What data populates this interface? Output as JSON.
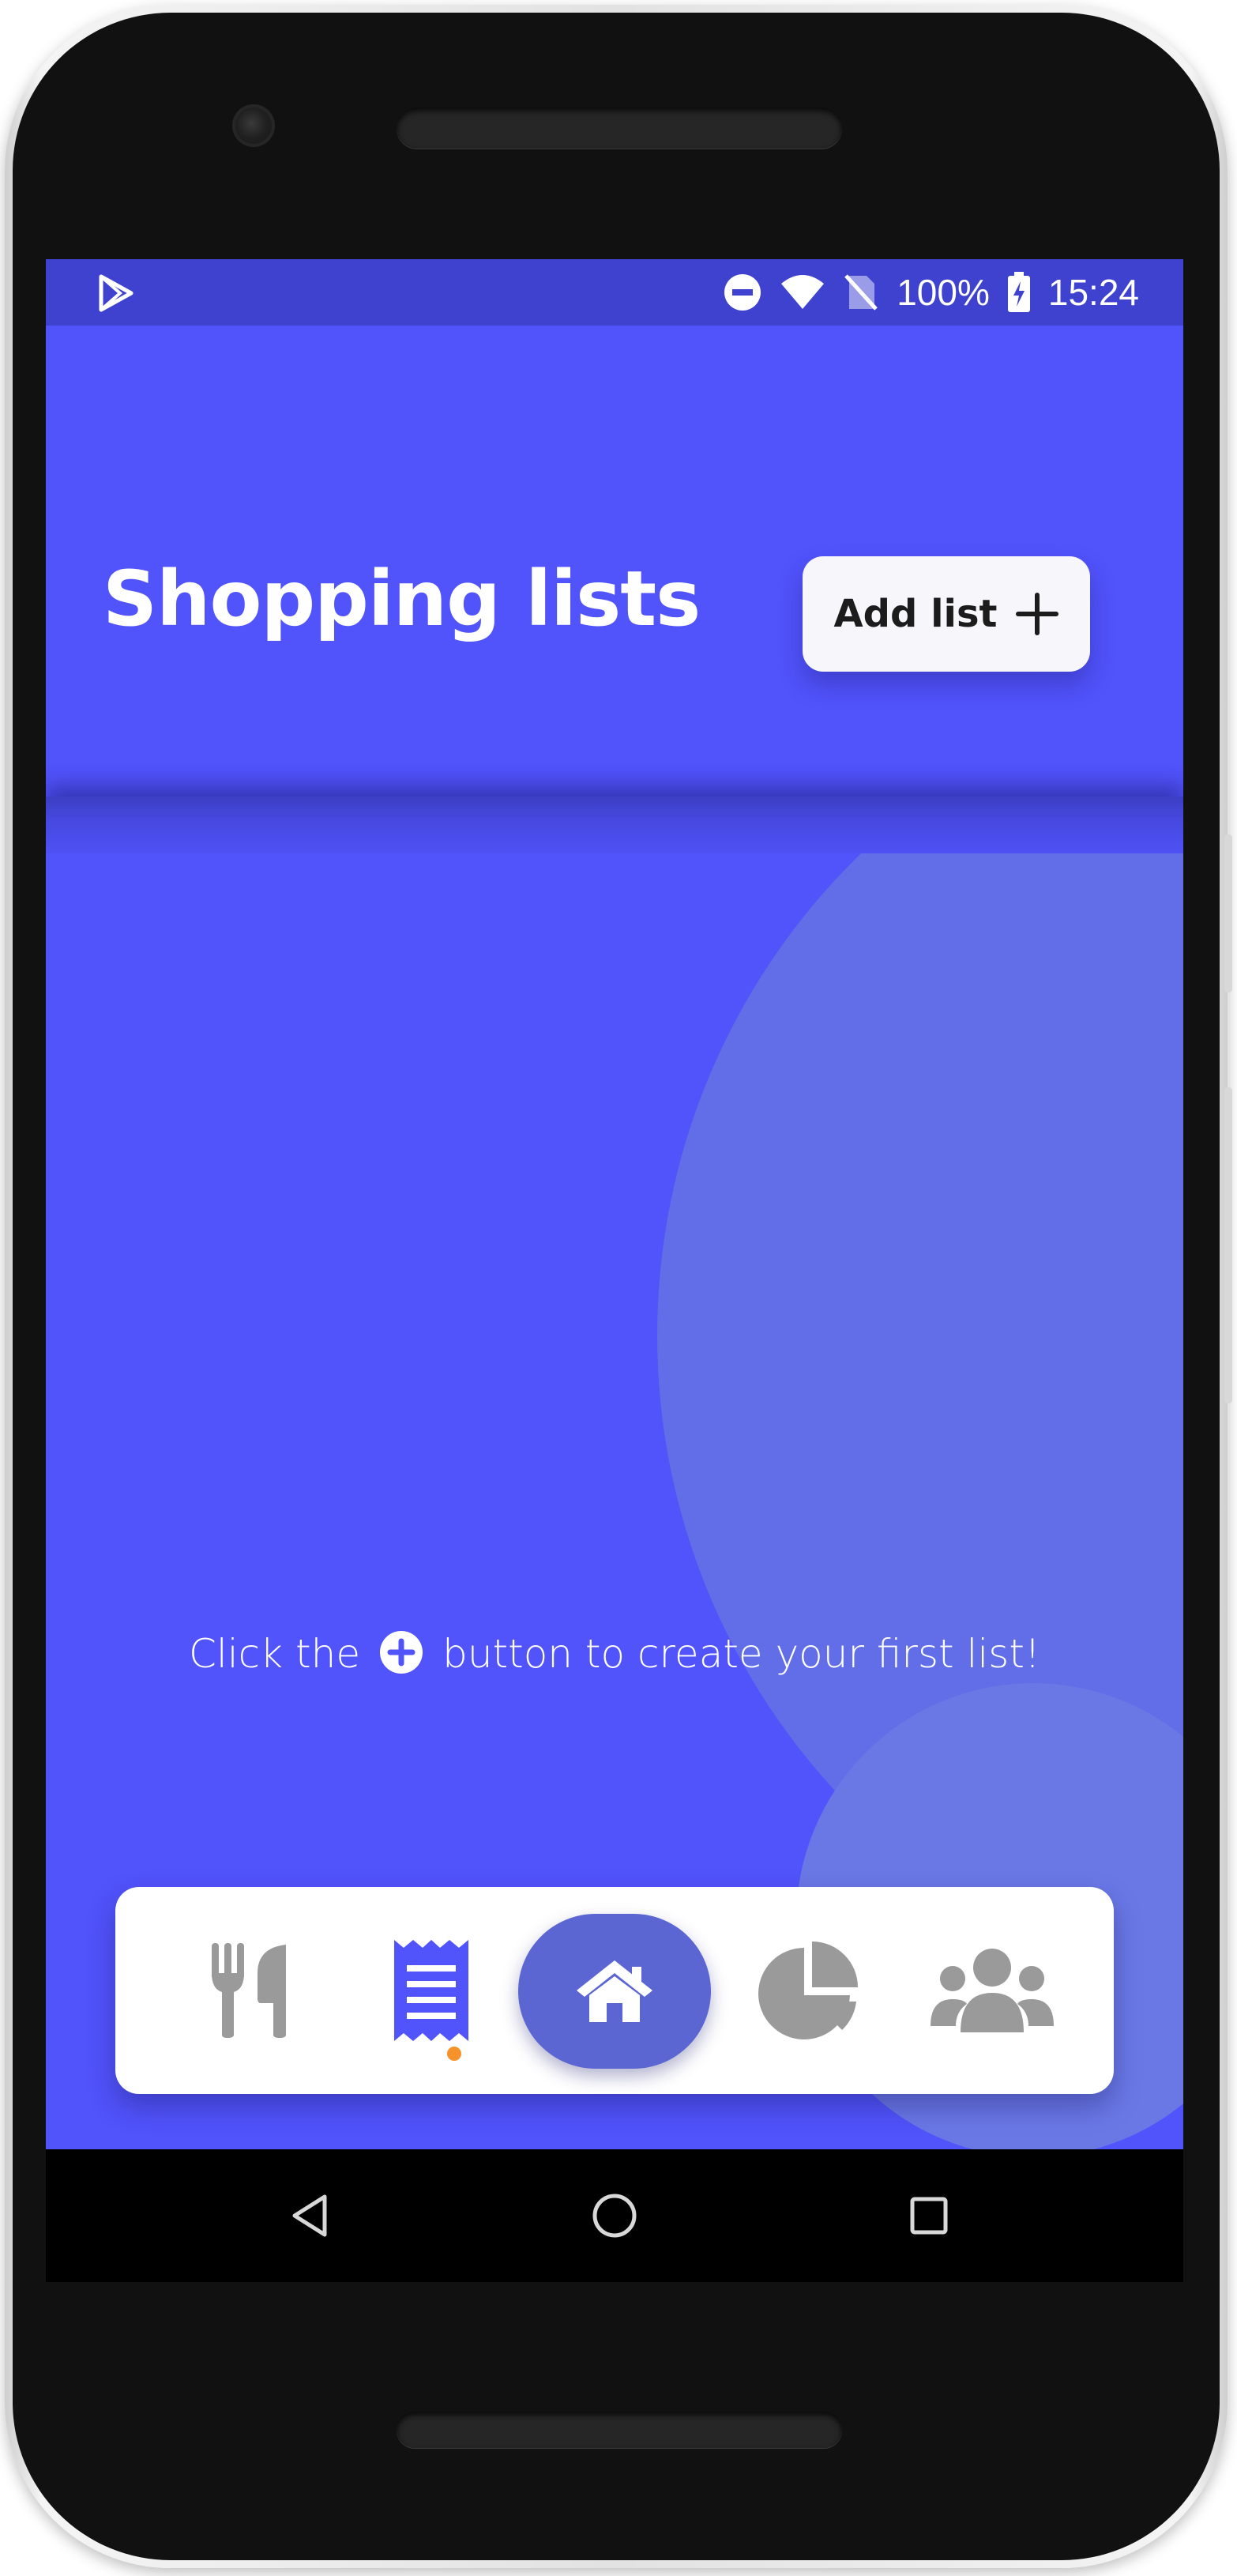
{
  "status_bar": {
    "battery": "100%",
    "time": "15:24",
    "icons": [
      "play-store-icon",
      "do-not-disturb-icon",
      "wifi-icon",
      "no-sim-icon",
      "battery-charging-icon"
    ]
  },
  "header": {
    "title": "Shopping lists",
    "add_button_label": "Add list",
    "add_button_icon": "plus-icon"
  },
  "empty_state": {
    "text_before": "Click the",
    "icon": "plus-circle-icon",
    "text_after": "button to create your first list!"
  },
  "bottom_nav": {
    "items": [
      {
        "icon": "fork-knife-icon",
        "active": false
      },
      {
        "icon": "receipt-list-icon",
        "active": true
      },
      {
        "icon": "home-icon",
        "active": false,
        "emphasized": true
      },
      {
        "icon": "pie-chart-icon",
        "active": false
      },
      {
        "icon": "users-group-icon",
        "active": false
      }
    ]
  },
  "system_nav": {
    "buttons": [
      "back-icon",
      "home-circle-icon",
      "recents-icon"
    ]
  },
  "colors": {
    "primary": "#5153fb",
    "status_bar": "#3f42cf",
    "active_nav": "#5153fb",
    "inactive_nav": "#9a9a9a",
    "indicator_dot": "#f5922a",
    "home_button": "#5b66d2"
  }
}
